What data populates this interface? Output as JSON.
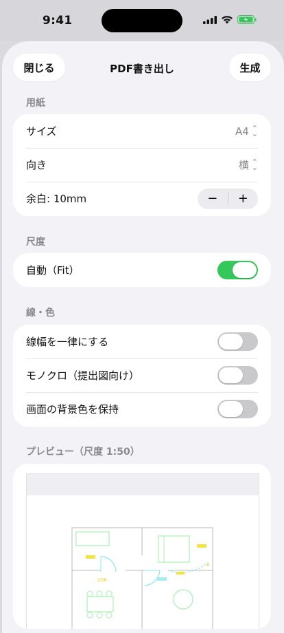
{
  "status": {
    "time": "9:41"
  },
  "nav": {
    "close": "閉じる",
    "title": "PDF書き出し",
    "generate": "生成"
  },
  "paper": {
    "header": "用紙",
    "size_label": "サイズ",
    "size_value": "A4",
    "orientation_label": "向き",
    "orientation_value": "横",
    "margin_label": "余白: 10mm",
    "minus": "−",
    "plus": "+"
  },
  "scale": {
    "header": "尺度",
    "auto_label": "自動（Fit）",
    "auto_on": true
  },
  "lines": {
    "header": "線・色",
    "uniform_label": "線幅を一律にする",
    "uniform_on": false,
    "mono_label": "モノクロ（提出図向け）",
    "mono_on": false,
    "bg_label": "画面の背景色を保持",
    "bg_on": false
  },
  "preview": {
    "header": "プレビュー（尺度 1:50）",
    "room_labels": [
      "LDK"
    ]
  },
  "colors": {
    "accent_green": "#34c759",
    "plan_yellow": "#f0e020",
    "plan_green": "#a8f0b0",
    "plan_cyan": "#8ee8ee"
  }
}
